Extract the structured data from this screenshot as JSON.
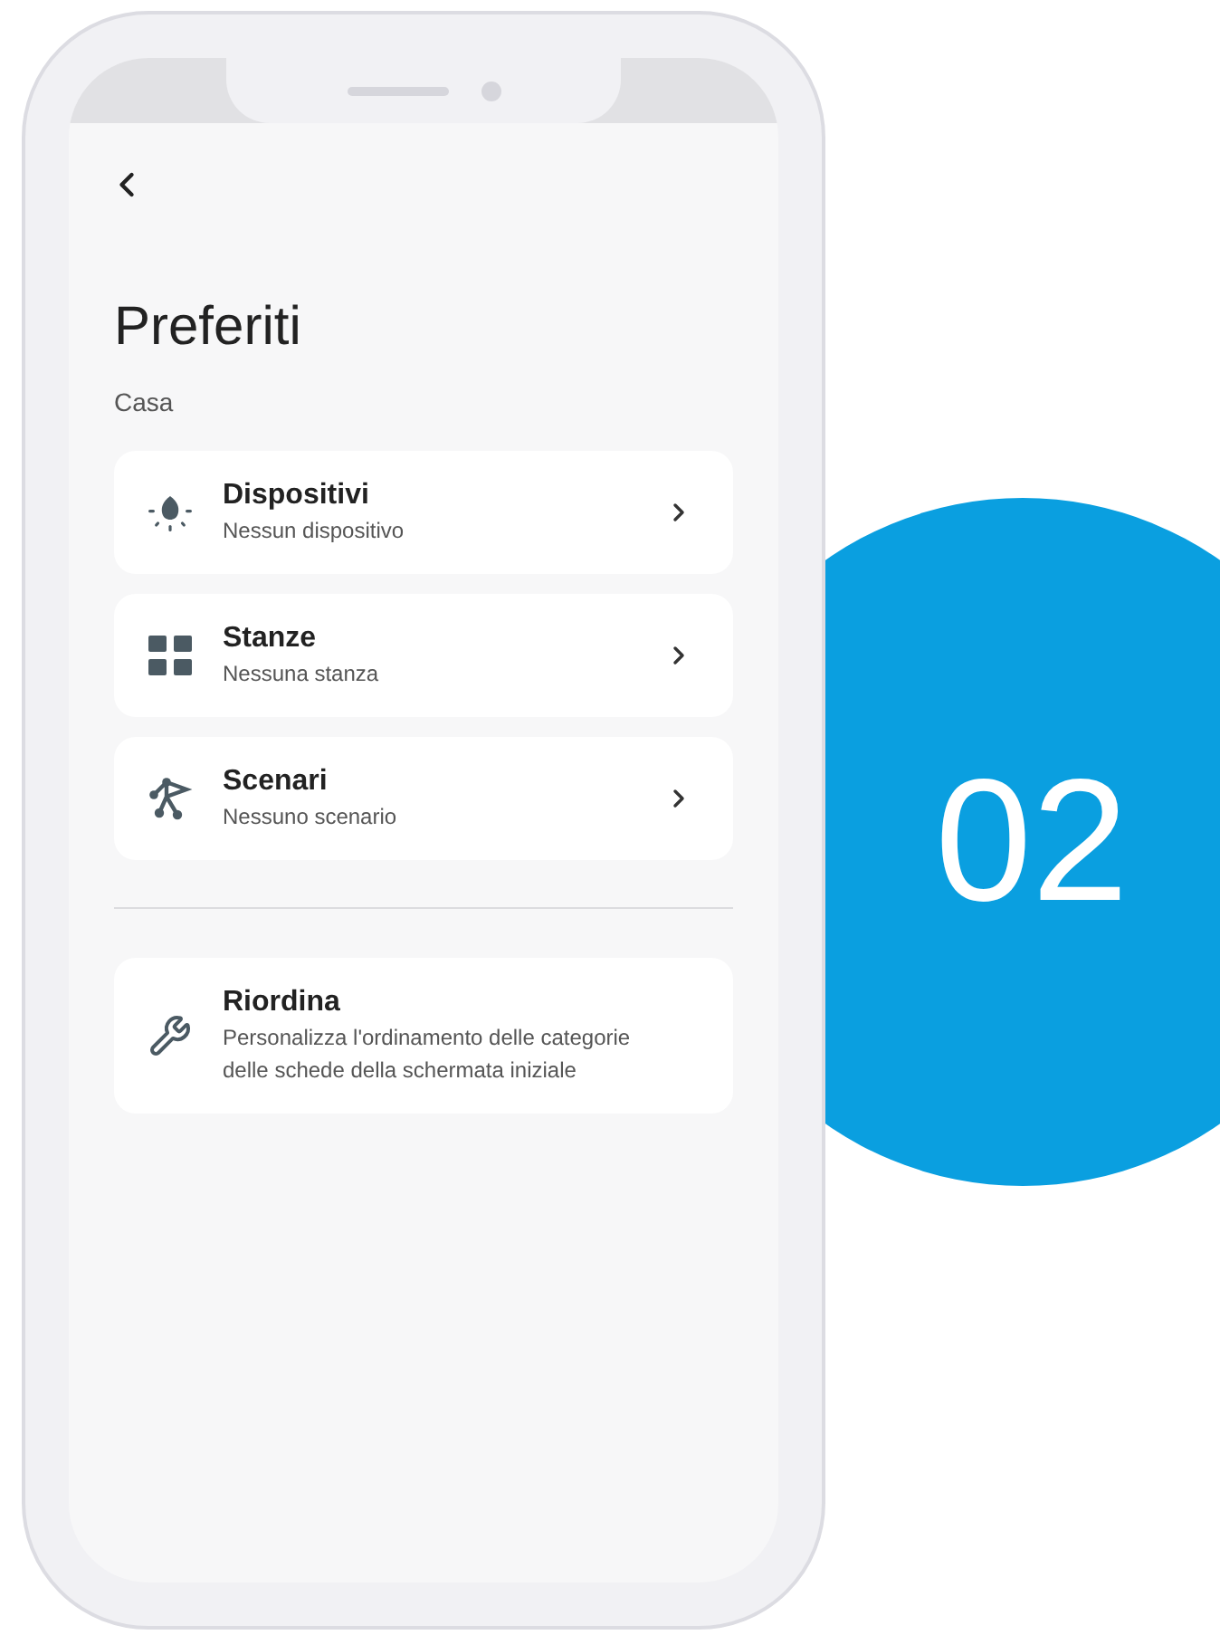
{
  "screen": {
    "title": "Preferiti",
    "subtitle": "Casa",
    "categories": [
      {
        "title": "Dispositivi",
        "subtitle": "Nessun dispositivo"
      },
      {
        "title": "Stanze",
        "subtitle": "Nessuna stanza"
      },
      {
        "title": "Scenari",
        "subtitle": "Nessuno scenario"
      }
    ],
    "reorder": {
      "title": "Riordina",
      "subtitle": "Personalizza l'ordinamento delle categorie delle schede della schermata iniziale"
    }
  },
  "step_badge": "02"
}
